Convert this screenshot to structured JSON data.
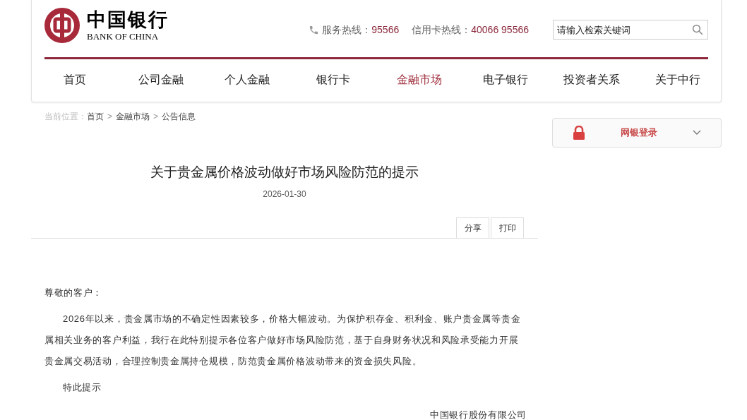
{
  "logo": {
    "name_cn": "中国银行",
    "name_en": "BANK OF CHINA"
  },
  "hotlines": [
    {
      "label": "服务热线：",
      "number": "95566"
    },
    {
      "label": "信用卡热线：",
      "number": "40066 95566"
    }
  ],
  "search": {
    "placeholder": "请输入检索关键词"
  },
  "nav": [
    {
      "label": "首页",
      "selected": false
    },
    {
      "label": "公司金融",
      "selected": false
    },
    {
      "label": "个人金融",
      "selected": false
    },
    {
      "label": "银行卡",
      "selected": false
    },
    {
      "label": "金融市场",
      "selected": true
    },
    {
      "label": "电子银行",
      "selected": false
    },
    {
      "label": "投资者关系",
      "selected": false
    },
    {
      "label": "关于中行",
      "selected": false
    }
  ],
  "breadcrumb": {
    "label": "当前位置：",
    "items": [
      "首页",
      "金融市场",
      "公告信息"
    ],
    "separator": ">"
  },
  "login": {
    "label": "网银登录"
  },
  "article": {
    "title": "关于贵金属价格波动做好市场风险防范的提示",
    "date": "2026-01-30",
    "actions": [
      "分享",
      "打印"
    ],
    "greeting": "尊敬的客户：",
    "paragraphs": [
      "2026年以来，贵金属市场的不确定性因素较多，价格大幅波动。为保护积存金、积利金、账户贵金属等贵金属相关业务的客户利益，我行在此特别提示各位客户做好市场风险防范，基于自身财务状况和风险承受能力开展贵金属交易活动，合理控制贵金属持仓规模，防范贵金属价格波动带来的资金损失风险。",
      "特此提示"
    ],
    "signature": "中国银行股份有限公司"
  }
}
